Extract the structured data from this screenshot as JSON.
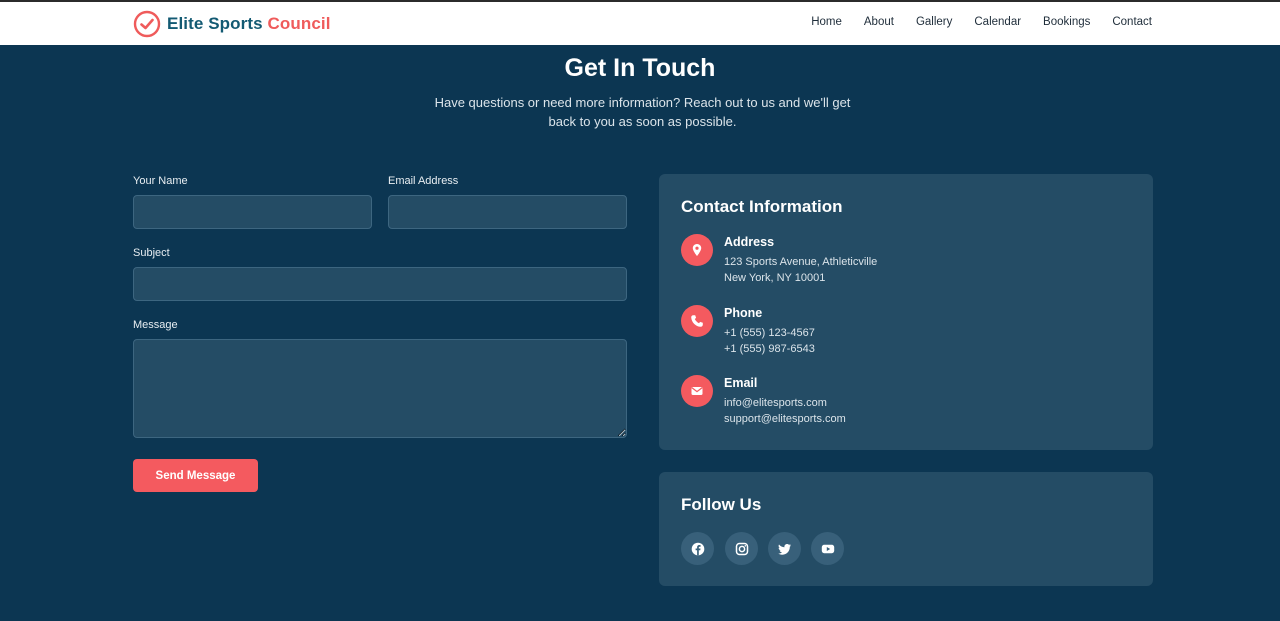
{
  "brand": {
    "name_part1": "Elite Sports",
    "name_part2": "Council",
    "logo_icon": "check-circle-icon"
  },
  "nav": [
    "Home",
    "About",
    "Gallery",
    "Calendar",
    "Bookings",
    "Contact"
  ],
  "hero": {
    "title": "Get In Touch",
    "subtitle_line1": "Have questions or need more information? Reach out to us and we'll get",
    "subtitle_line2": "back to you as soon as possible."
  },
  "form": {
    "name_label": "Your Name",
    "name_value": "",
    "email_label": "Email Address",
    "email_value": "",
    "subject_label": "Subject",
    "subject_value": "",
    "message_label": "Message",
    "message_value": "",
    "submit_label": "Send Message"
  },
  "contact": {
    "title": "Contact Information",
    "address": {
      "heading": "Address",
      "lines": [
        "123 Sports Avenue, Athleticville",
        "New York, NY 10001"
      ],
      "icon": "map-pin-icon"
    },
    "phone": {
      "heading": "Phone",
      "lines": [
        "+1 (555) 123-4567",
        "+1 (555) 987-6543"
      ],
      "icon": "phone-icon"
    },
    "email": {
      "heading": "Email",
      "lines": [
        "info@elitesports.com",
        "support@elitesports.com"
      ],
      "icon": "envelope-icon"
    }
  },
  "follow": {
    "title": "Follow Us",
    "icons": [
      "facebook-icon",
      "instagram-icon",
      "twitter-icon",
      "youtube-icon"
    ]
  },
  "colors": {
    "navy": "#0c3652",
    "card": "#244c65",
    "accent": "#f45a5f",
    "brand_teal": "#135a73"
  }
}
